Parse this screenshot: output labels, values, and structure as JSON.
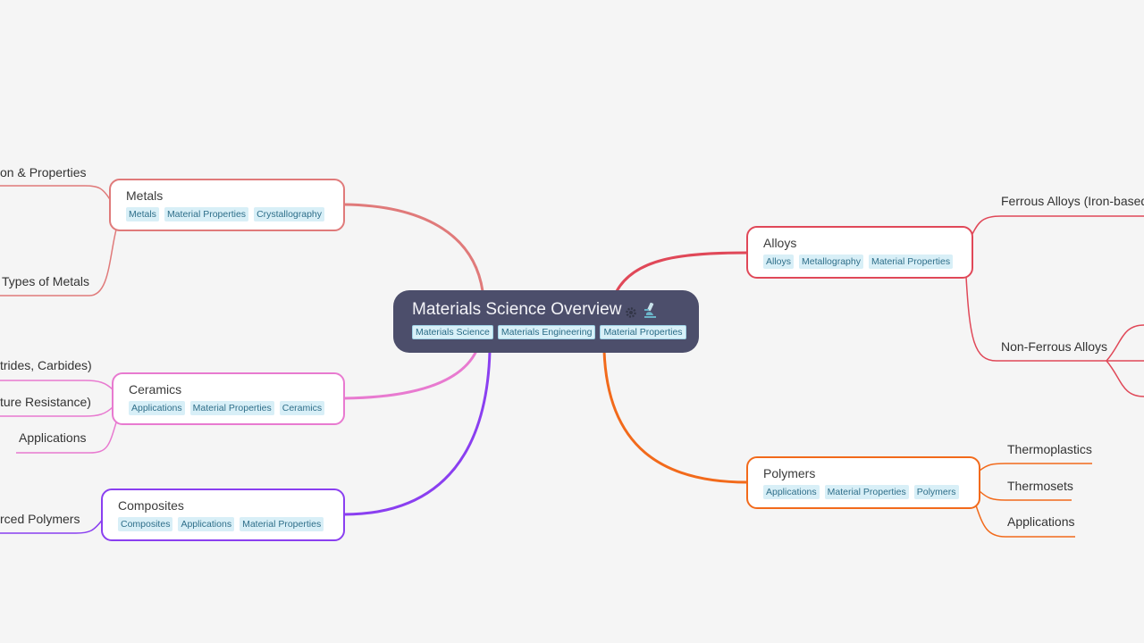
{
  "root": {
    "title": "Materials Science Overview",
    "icons": [
      "gear-icon",
      "microscope-icon"
    ],
    "tags": [
      "Materials Science",
      "Materials Engineering",
      "Material Properties"
    ]
  },
  "branches": [
    {
      "id": "metals",
      "title": "Metals",
      "color": "#e07a7a",
      "tags": [
        "Metals",
        "Material Properties",
        "Crystallography"
      ],
      "children": [
        "Composition & Properties",
        "Types of Metals"
      ],
      "children_visible": [
        "on & Properties",
        "Types of Metals"
      ]
    },
    {
      "id": "ceramics",
      "title": "Ceramics",
      "color": "#e87ad0",
      "tags": [
        "Applications",
        "Material Properties",
        "Ceramics"
      ],
      "children_visible": [
        "trides, Carbides)",
        "ture Resistance)",
        "Applications"
      ]
    },
    {
      "id": "composites",
      "title": "Composites",
      "color": "#8a3ff0",
      "tags": [
        "Composites",
        "Applications",
        "Material Properties"
      ],
      "children_visible": [
        "rced Polymers"
      ]
    },
    {
      "id": "alloys",
      "title": "Alloys",
      "color": "#e04858",
      "tags": [
        "Alloys",
        "Metallography",
        "Material Properties"
      ],
      "children_visible": [
        "Ferrous Alloys (Iron-based)",
        "Non-Ferrous Alloys"
      ]
    },
    {
      "id": "polymers",
      "title": "Polymers",
      "color": "#f26a1b",
      "tags": [
        "Applications",
        "Material Properties",
        "Polymers"
      ],
      "children_visible": [
        "Thermoplastics",
        "Thermosets",
        "Applications"
      ]
    }
  ]
}
